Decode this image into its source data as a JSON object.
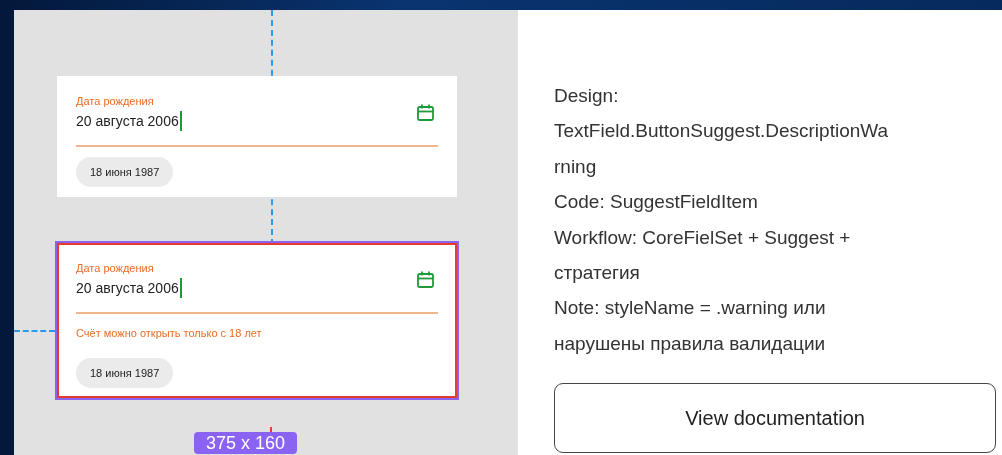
{
  "canvas": {
    "fields": [
      {
        "label": "Дата рождения",
        "value": "20 августа 2006",
        "cursor": true,
        "suggestion": "18 июня 1987",
        "selected": false
      },
      {
        "label": "Дата рождения",
        "value": "20 августа 2006",
        "cursor": true,
        "error": "Счёт можно открыть только с 18 лет",
        "suggestion": "18 июня 1987",
        "selected": true
      }
    ],
    "size_badge": "375 x 160"
  },
  "details": {
    "lines": [
      "Design:",
      "TextField.ButtonSuggest.DescriptionWa",
      "rning",
      "Code: SuggestFieldItem",
      "Workflow: CoreFielSet + Suggest +",
      "стратегия",
      "Note: styleName = .warning или",
      "нарушены правила валидации"
    ],
    "button": "View documentation"
  }
}
